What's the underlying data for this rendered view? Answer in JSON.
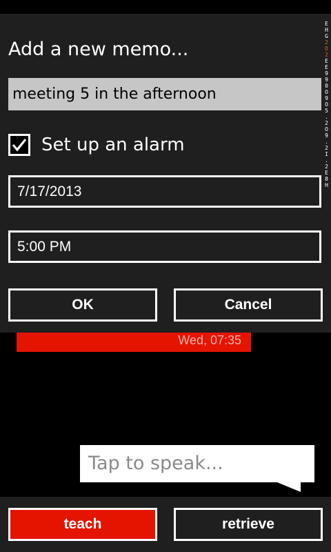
{
  "dialog": {
    "title": "Add a new memo...",
    "memo_value": "meeting 5 in the afternoon",
    "alarm_checked": true,
    "alarm_label": "Set up an alarm",
    "date_value": "7/17/2013",
    "time_value": "5:00 PM",
    "ok_label": "OK",
    "cancel_label": "Cancel"
  },
  "side_strip": {
    "part1": "EHG",
    "accent": "2O2",
    "part2": "EE990O9O5.2O9.2I.2E8H"
  },
  "memo_list": {
    "item_time": "Wed, 07:35"
  },
  "speech": {
    "prompt": "Tap to speak..."
  },
  "app_bar": {
    "teach_label": "teach",
    "retrieve_label": "retrieve"
  },
  "colors": {
    "accent_red": "#e51400",
    "panel": "#1f1f1f",
    "input_bg": "#c6c6c6"
  },
  "icons": {
    "checkbox": "checkmark-icon"
  }
}
